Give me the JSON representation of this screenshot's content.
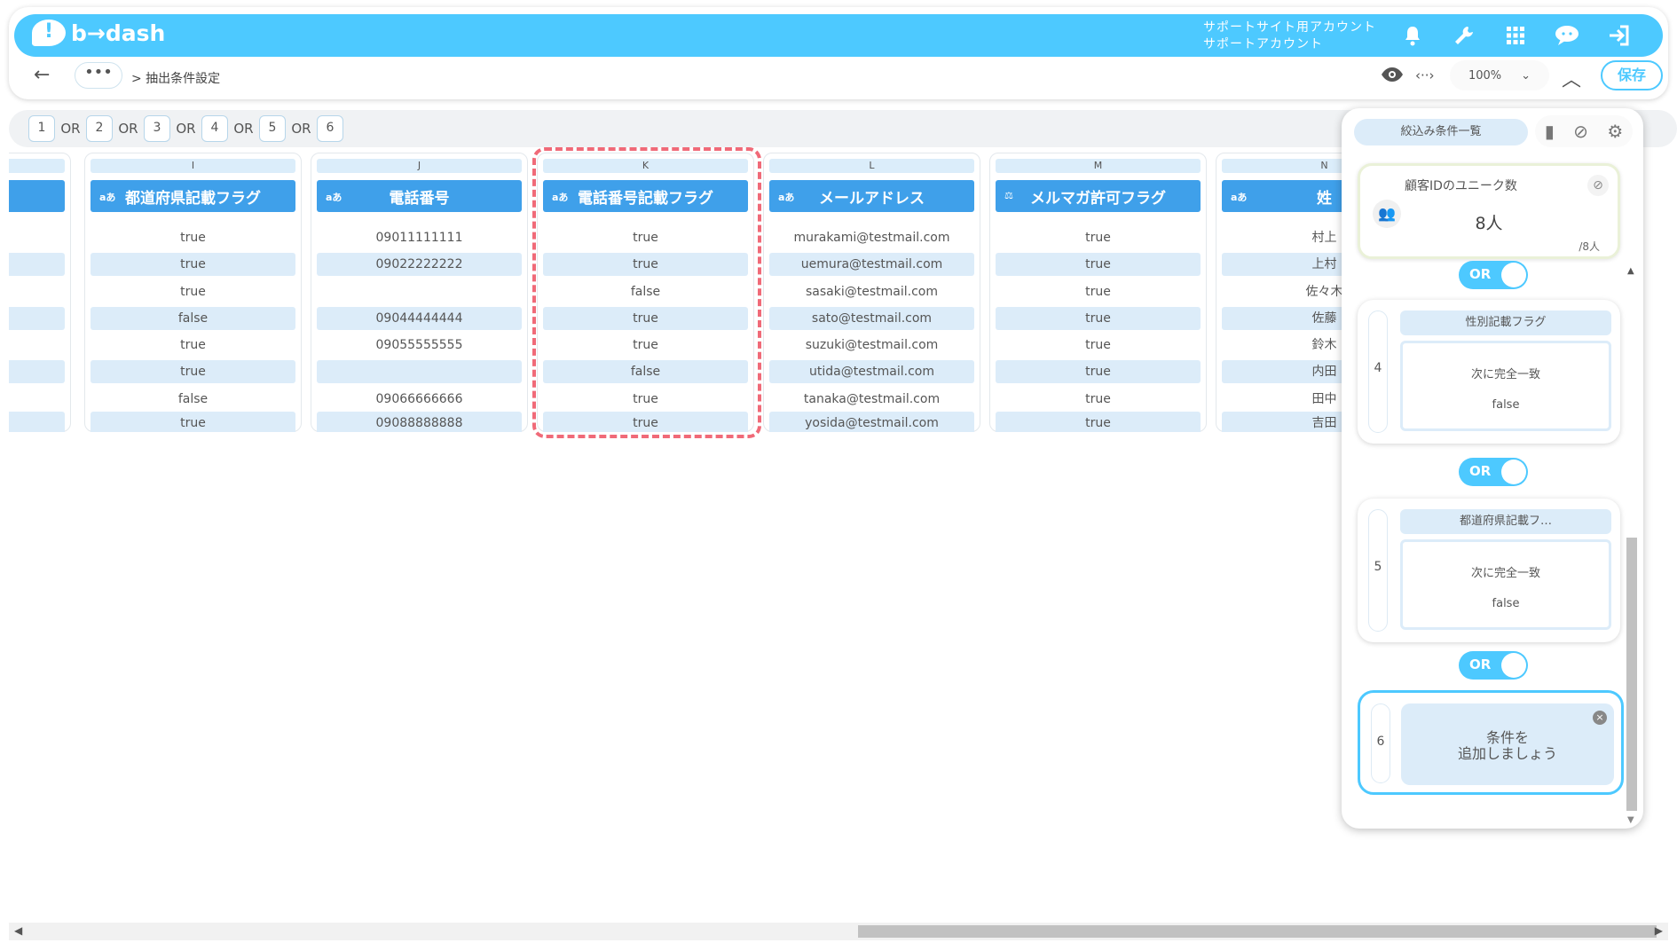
{
  "app": {
    "logo": "b→dash",
    "account_line1": "サポートサイト用アカウント",
    "account_line2": "サポートアカウント",
    "icons": [
      "bell-icon",
      "wrench-icon",
      "grid-icon",
      "support-icon",
      "logout-icon"
    ]
  },
  "subbar": {
    "back_icon": "arrow-left-icon",
    "more": "•••",
    "breadcrumb": "> 抽出条件設定",
    "zoom": "100%",
    "save": "保存"
  },
  "or_strip": {
    "items": [
      "1",
      "2",
      "3",
      "4",
      "5",
      "6"
    ],
    "joiner": "OR"
  },
  "columns": [
    {
      "letter": "",
      "header": "",
      "type": "",
      "values": [
        "",
        "",
        "",
        "",
        "",
        "",
        "",
        ""
      ]
    },
    {
      "letter": "I",
      "header": "都道府県記載フラグ",
      "type": "aあ",
      "values": [
        "true",
        "true",
        "true",
        "false",
        "true",
        "true",
        "false",
        "true"
      ]
    },
    {
      "letter": "J",
      "header": "電話番号",
      "type": "aあ",
      "values": [
        "09011111111",
        "09022222222",
        "",
        "09044444444",
        "09055555555",
        "",
        "09066666666",
        "09088888888"
      ]
    },
    {
      "letter": "K",
      "header": "電話番号記載フラグ",
      "type": "aあ",
      "values": [
        "true",
        "true",
        "false",
        "true",
        "true",
        "false",
        "true",
        "true"
      ]
    },
    {
      "letter": "L",
      "header": "メールアドレス",
      "type": "aあ",
      "values": [
        "murakami@testmail.com",
        "uemura@testmail.com",
        "sasaki@testmail.com",
        "sato@testmail.com",
        "suzuki@testmail.com",
        "utida@testmail.com",
        "tanaka@testmail.com",
        "yosida@testmail.com"
      ]
    },
    {
      "letter": "M",
      "header": "メルマガ許可フラグ",
      "type": "⚖",
      "values": [
        "true",
        "true",
        "true",
        "true",
        "true",
        "true",
        "true",
        "true"
      ]
    },
    {
      "letter": "N",
      "header": "姓",
      "type": "aあ",
      "values": [
        "村上",
        "上村",
        "佐々木",
        "佐藤",
        "鈴木",
        "内田",
        "田中",
        "吉田"
      ]
    }
  ],
  "panel": {
    "title": "絞込み条件一覧",
    "unique_title": "顧客IDのユニーク数",
    "unique_value": "8人",
    "unique_total": "/8人",
    "or_label": "OR",
    "conditions": [
      {
        "num": "4",
        "field": "性別記載フラグ",
        "op": "次に完全一致",
        "value": "false"
      },
      {
        "num": "5",
        "field": "都道府県記載フ…",
        "op": "次に完全一致",
        "value": "false"
      }
    ],
    "add": {
      "num": "6",
      "line1": "条件を",
      "line2": "追加しましょう"
    }
  }
}
